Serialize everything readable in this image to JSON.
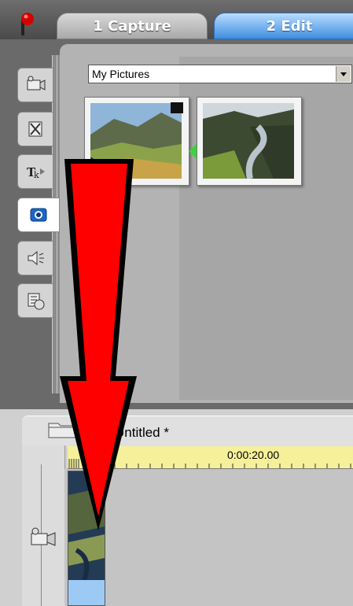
{
  "tabs": [
    {
      "label": "1 Capture",
      "active": false
    },
    {
      "label": "2 Edit",
      "active": true
    }
  ],
  "album": {
    "source_select": {
      "value": "My Pictures"
    },
    "side_tabs": [
      "video-tab-icon",
      "transitions-tab-icon",
      "titles-tab-icon",
      "photos-tab-icon",
      "sound-effects-tab-icon",
      "disc-menus-tab-icon"
    ],
    "active_side_tab": "photos-tab-icon",
    "thumbnails": [
      {
        "name": "photo-thumbnail-1",
        "checked": true
      },
      {
        "name": "photo-thumbnail-2",
        "checked": false
      }
    ]
  },
  "timeline": {
    "project_title": "Untitled *",
    "ruler_time": "0:00:20.00"
  },
  "colors": {
    "edit_tab": "#3f8fe0",
    "ruler": "#f6f09a",
    "clip_selected": "#9ccaf5",
    "arrow": "#ff0000"
  }
}
